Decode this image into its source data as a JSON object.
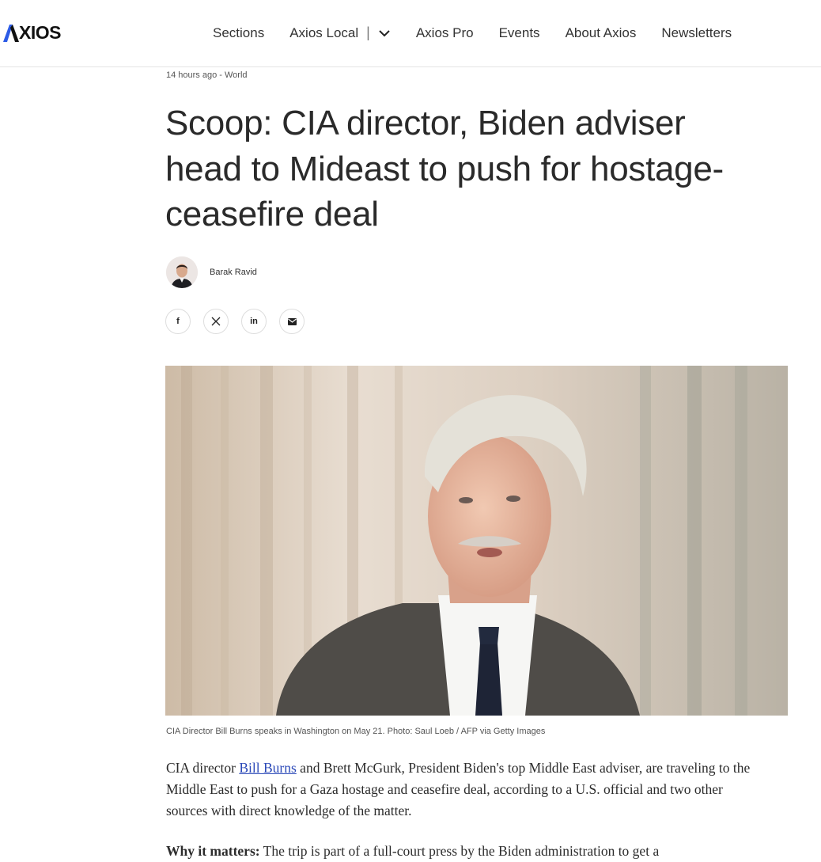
{
  "header": {
    "logo_text": "XIOS",
    "logo_accent": "#2c5be6",
    "nav": {
      "sections": "Sections",
      "axios_local": "Axios Local",
      "separator": "|",
      "axios_pro": "Axios Pro",
      "events": "Events",
      "about": "About Axios",
      "newsletters": "Newsletters"
    }
  },
  "article": {
    "meta": "14 hours ago - World",
    "headline": "Scoop: CIA director, Biden adviser head to Mideast to push for hostage-ceasefire deal",
    "author": "Barak Ravid",
    "share_icons": [
      "facebook-icon",
      "x-icon",
      "linkedin-icon",
      "email-icon"
    ],
    "share": {
      "facebook": "f",
      "linkedin": "in"
    },
    "caption": "CIA Director Bill Burns speaks in Washington on May 21. Photo: Saul Loeb / AFP via Getty Images",
    "p1": {
      "before": "CIA director ",
      "link": "Bill Burns",
      "after": " and Brett McGurk, President Biden's top Middle East adviser, are traveling to the Middle East to push for a Gaza hostage and ceasefire deal, according to a U.S. official and two other sources with direct knowledge of the matter."
    },
    "p2": {
      "lead": "Why it matters:",
      "text": " The trip is part of a full-court press by the Biden administration to get a"
    }
  }
}
